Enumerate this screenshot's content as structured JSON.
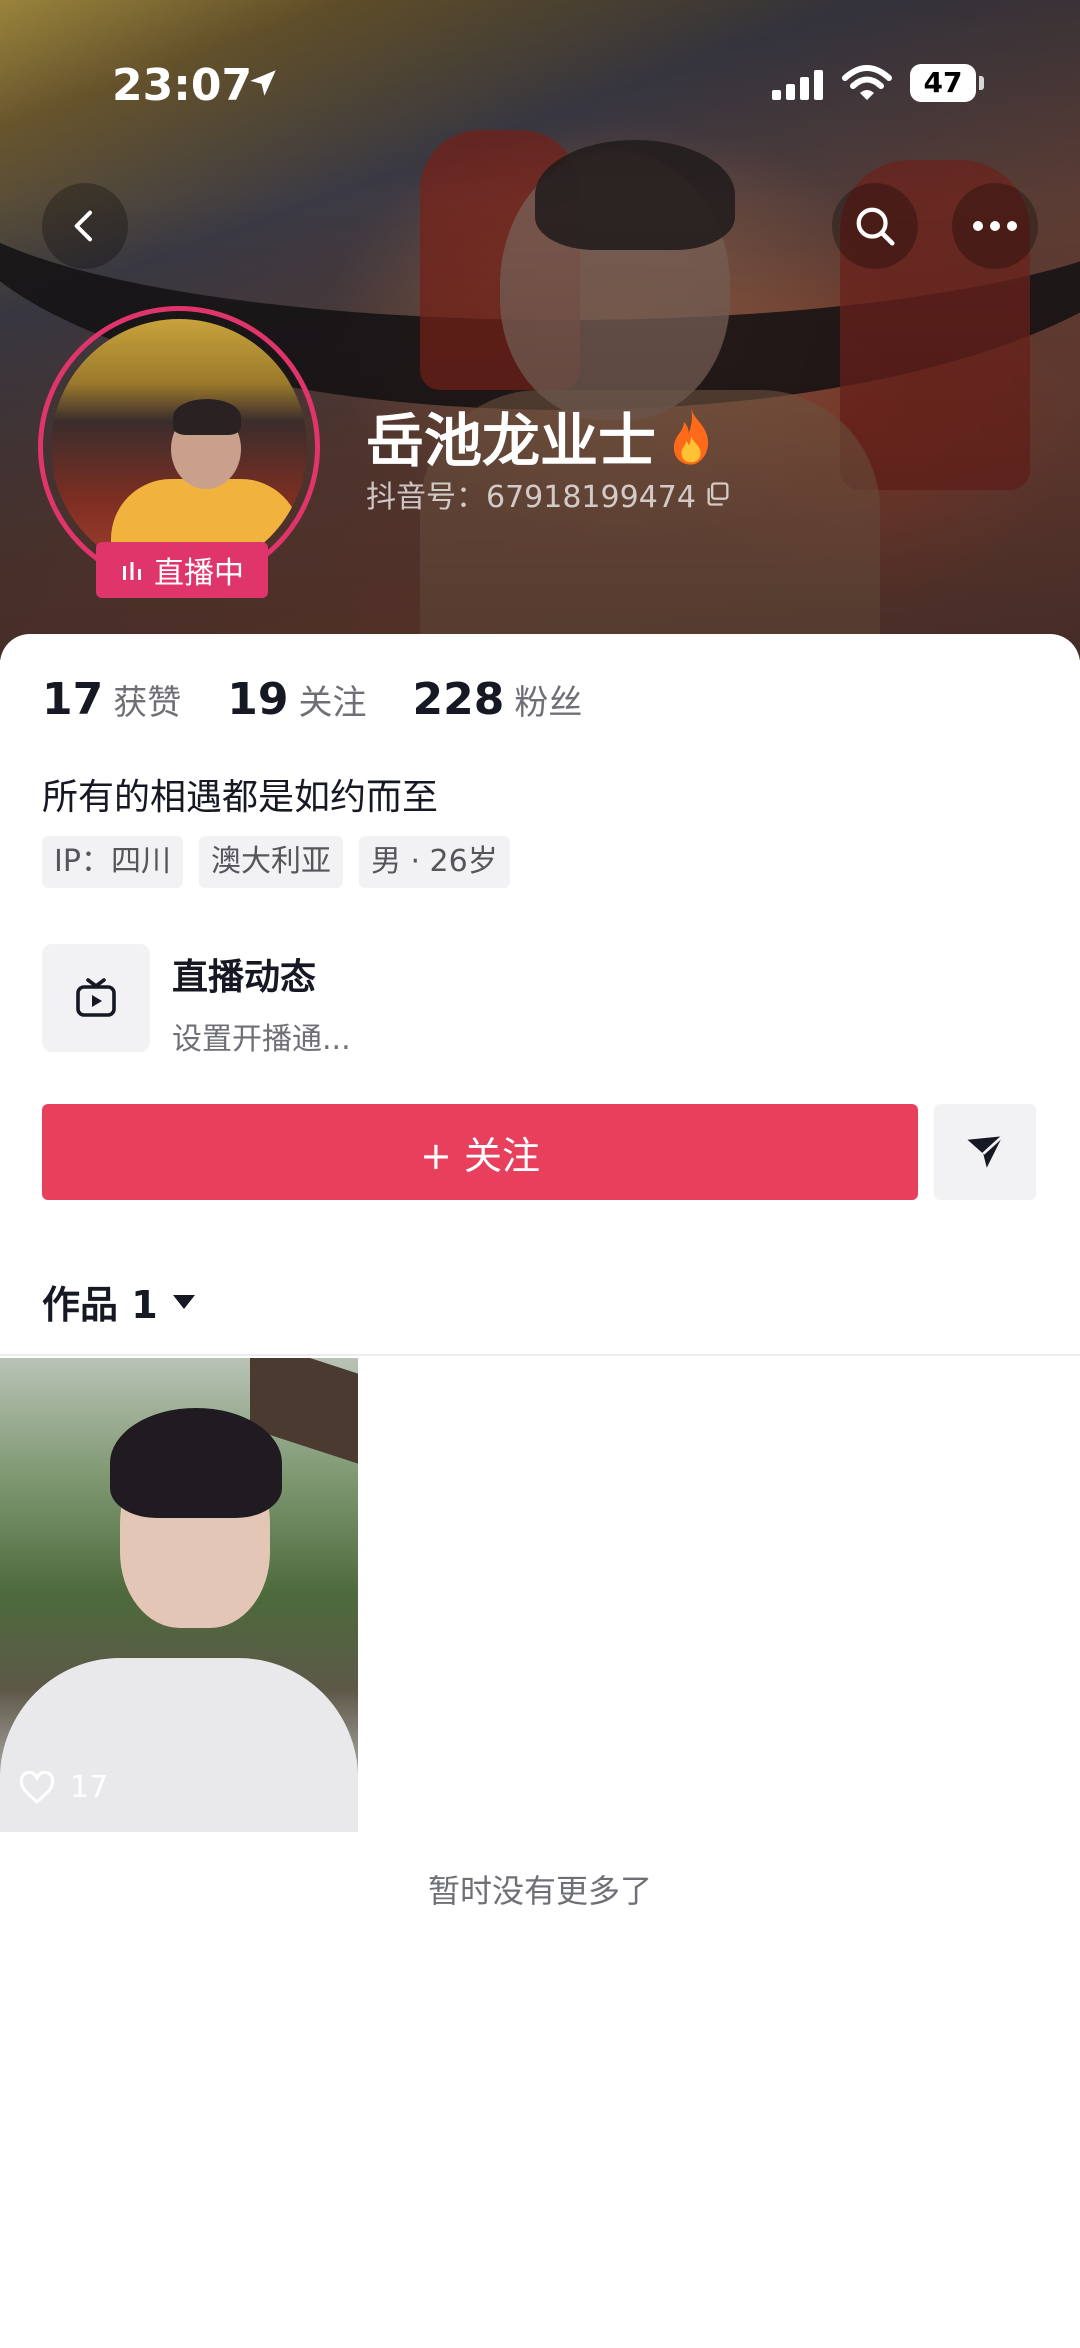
{
  "status_bar": {
    "time": "23:07",
    "battery": "47"
  },
  "profile": {
    "nickname": "岳池龙业士",
    "douyin_id": "抖音号：67918199474",
    "live_badge": "直播中",
    "stats": [
      {
        "value": "17",
        "label": "获赞"
      },
      {
        "value": "19",
        "label": "关注"
      },
      {
        "value": "228",
        "label": "粉丝"
      }
    ],
    "bio": "所有的相遇都是如约而至",
    "tags": [
      "IP：四川",
      "澳大利亚",
      "男 · 26岁"
    ]
  },
  "live_feed": {
    "title": "直播动态",
    "subtitle": "设置开播通..."
  },
  "actions": {
    "follow_label": "+ 关注"
  },
  "works": {
    "tab_label": "作品 1",
    "videos": [
      {
        "likes": "17"
      }
    ],
    "end_text": "暂时没有更多了"
  },
  "colors": {
    "accent": "#e8405c",
    "live_pink": "#e0356b"
  }
}
